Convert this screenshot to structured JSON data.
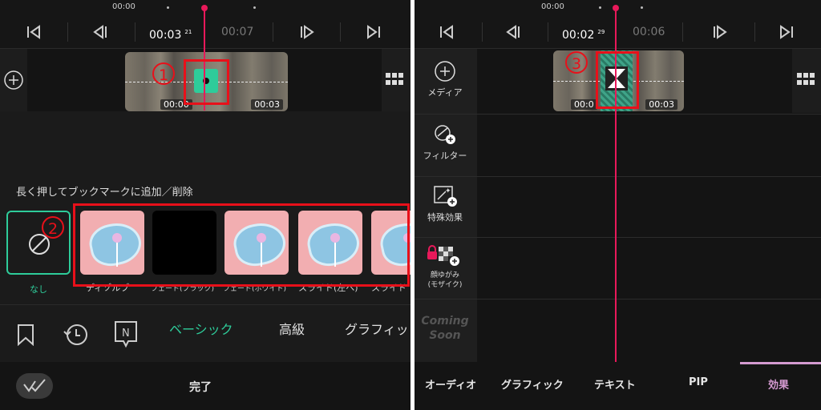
{
  "left": {
    "ruler": {
      "start": "00:00"
    },
    "controls": {
      "current_time": "00:03",
      "current_frame": "21",
      "total_time": "00:07"
    },
    "clip": {
      "start_label": "00:00",
      "end_label": "00:03"
    },
    "hint": "長く押してブックマークに追加／削除",
    "none_label": "なし",
    "transitions": [
      {
        "label": "ディゾルブ",
        "style": "plate"
      },
      {
        "label": "フェード(ブラック)",
        "style": "black"
      },
      {
        "label": "フェード(ホワイト)",
        "style": "plate"
      },
      {
        "label": "スライド(左へ)",
        "style": "plate"
      },
      {
        "label": "スライド",
        "style": "plate"
      }
    ],
    "category_tabs": {
      "basic": "ベーシック",
      "advanced": "高級",
      "graphic": "グラフィッ"
    },
    "done_label": "完了",
    "annotations": {
      "n1": "1",
      "n2": "2"
    }
  },
  "right": {
    "ruler": {
      "start": "00:00"
    },
    "controls": {
      "current_time": "00:02",
      "current_frame": "29",
      "total_time": "00:06"
    },
    "clip": {
      "start_label": "00:0",
      "end_label": "00:03"
    },
    "side_items": {
      "media": "メディア",
      "filter": "フィルター",
      "special": "特殊効果",
      "mosaic": "顔ゆがみ\n(モザイク)",
      "coming": "Coming\nSoon"
    },
    "bottom_tabs": [
      "オーディオ",
      "グラフィック",
      "テキスト",
      "PIP",
      "効果"
    ],
    "annotations": {
      "n3": "3"
    }
  },
  "colors": {
    "accent": "#2ecc9a",
    "playhead": "#e8195a",
    "annotation": "#e8101a",
    "tab_active": "#d49ad0"
  }
}
